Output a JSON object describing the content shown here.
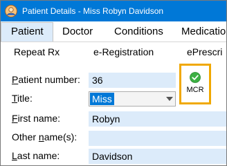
{
  "window": {
    "title": "Patient Details - Miss Robyn Davidson"
  },
  "tabs": [
    {
      "label": "Patient",
      "active": true
    },
    {
      "label": "Doctor"
    },
    {
      "label": "Conditions"
    },
    {
      "label": "Medicatio"
    }
  ],
  "subtabs": [
    {
      "label": "Repeat Rx"
    },
    {
      "label": "e-Registration"
    },
    {
      "label": "ePrescri"
    }
  ],
  "form": {
    "patient_number": {
      "label_u": "P",
      "label_rest": "atient number:",
      "value": "36"
    },
    "title": {
      "label_u": "T",
      "label_rest": "itle:",
      "value": "Miss"
    },
    "first_name": {
      "label_u": "F",
      "label_rest": "irst name:",
      "value": "Robyn"
    },
    "other_names": {
      "label_pre": "Other ",
      "label_u": "n",
      "label_rest": "ame(s):",
      "value": ""
    },
    "last_name": {
      "label_u": "L",
      "label_rest": "ast name:",
      "value": "Davidson"
    }
  },
  "mcr": {
    "label": "MCR",
    "status_color": "#3cb043"
  },
  "colors": {
    "titlebar": "#0078d7",
    "field_bg": "#dcebfa",
    "highlight_border": "#f0a800"
  }
}
